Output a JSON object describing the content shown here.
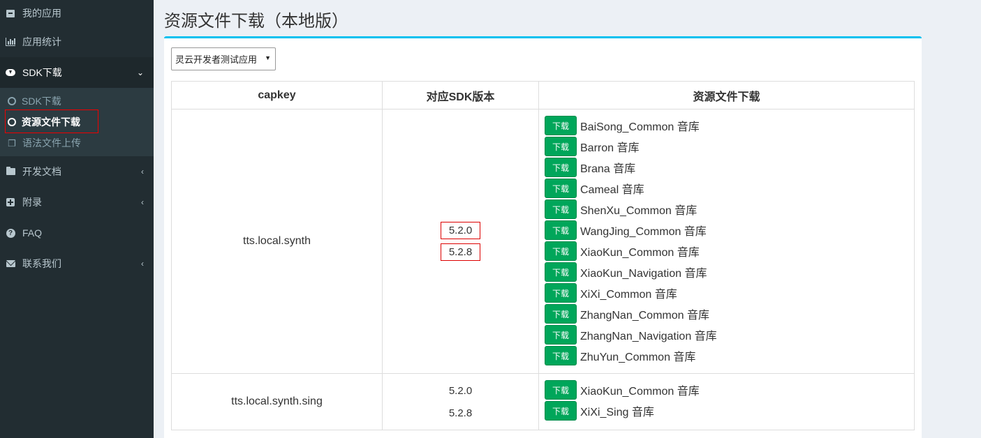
{
  "sidebar": {
    "items": [
      {
        "label": "我的应用",
        "icon": "archive-icon"
      },
      {
        "label": "应用统计",
        "icon": "bar-chart-icon"
      },
      {
        "label": "SDK下载",
        "icon": "cloud-download-icon"
      },
      {
        "label": "开发文档",
        "icon": "folder-icon"
      },
      {
        "label": "附录",
        "icon": "plus-square-icon"
      },
      {
        "label": "FAQ",
        "icon": "question-circle-icon"
      },
      {
        "label": "联系我们",
        "icon": "envelope-icon"
      }
    ],
    "submenu": [
      {
        "label": "SDK下载"
      },
      {
        "label": "资源文件下载"
      },
      {
        "label": "语法文件上传"
      }
    ]
  },
  "page": {
    "title": "资源文件下载（本地版）"
  },
  "app_select": {
    "value": "灵云开发者测试应用"
  },
  "table": {
    "headers": [
      "capkey",
      "对应SDK版本",
      "资源文件下载"
    ],
    "download_label": "下载",
    "rows": [
      {
        "capkey": "tts.local.synth",
        "versions": [
          "5.2.0",
          "5.2.8"
        ],
        "resources": [
          "BaiSong_Common 音库",
          "Barron 音库",
          "Brana 音库",
          "Cameal 音库",
          "ShenXu_Common 音库",
          "WangJing_Common 音库",
          "XiaoKun_Common 音库",
          "XiaoKun_Navigation 音库",
          "XiXi_Common 音库",
          "ZhangNan_Common 音库",
          "ZhangNan_Navigation 音库",
          "ZhuYun_Common 音库"
        ]
      },
      {
        "capkey": "tts.local.synth.sing",
        "versions": [
          "5.2.0",
          "5.2.8"
        ],
        "resources": [
          "XiaoKun_Common 音库",
          "XiXi_Sing 音库"
        ]
      }
    ]
  },
  "colors": {
    "sidebar_bg": "#222d32",
    "box_top_border": "#00c0ef",
    "download_button": "#00a65a",
    "highlight_border": "#e00000"
  }
}
